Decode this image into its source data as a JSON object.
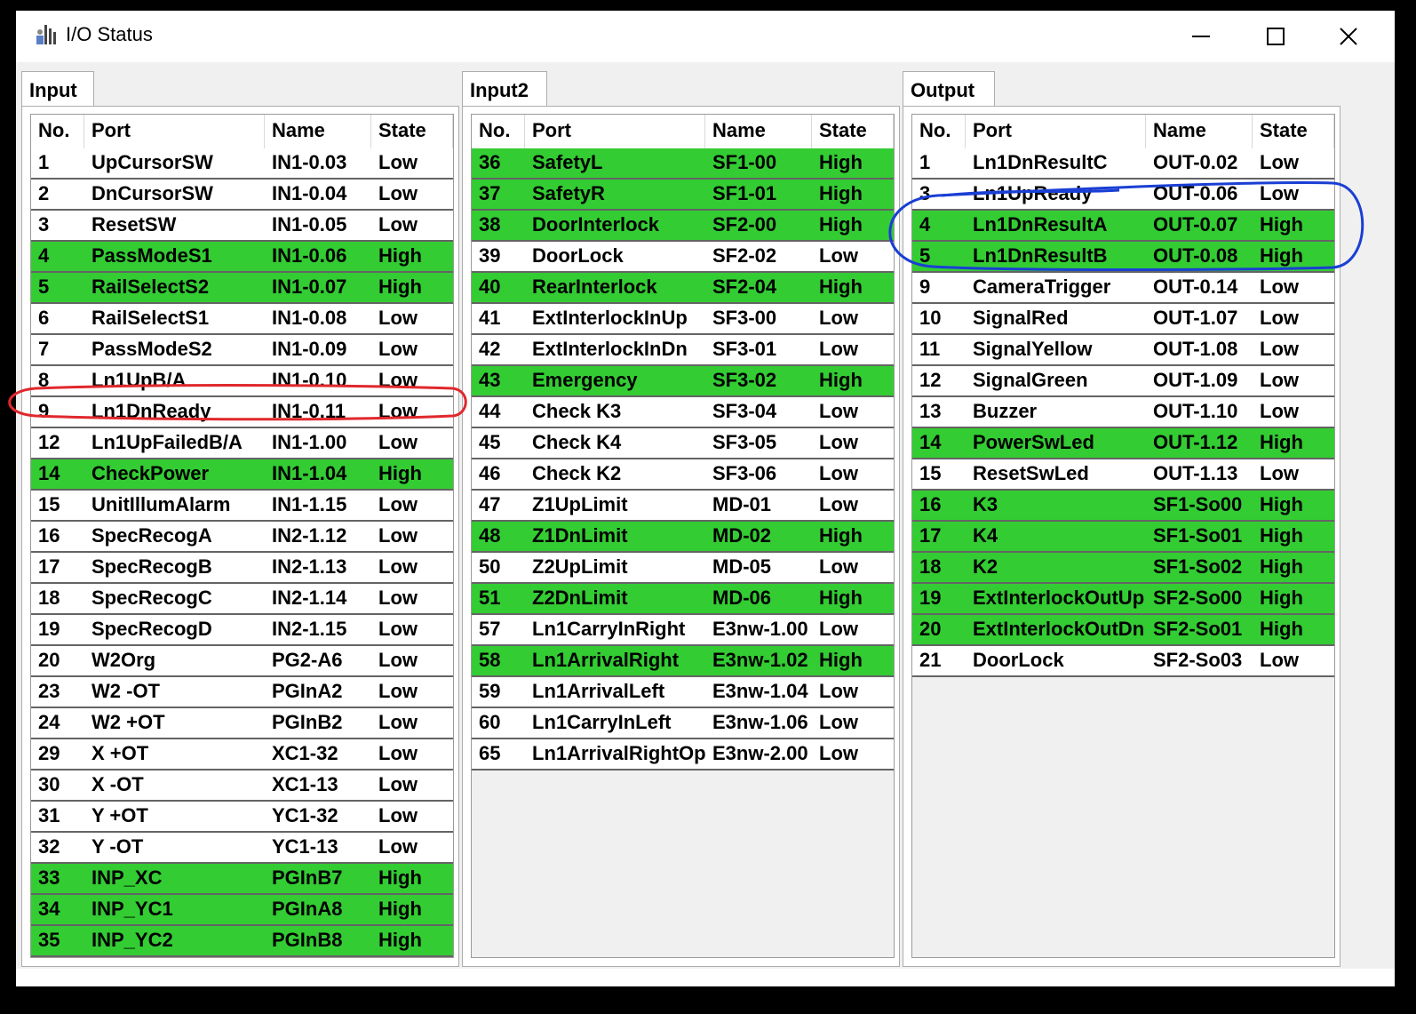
{
  "window": {
    "title": "I/O Status",
    "minimize_glyph": "—",
    "maximize_glyph": "☐",
    "close_glyph": "✕"
  },
  "columns": {
    "no": "No.",
    "port": "Port",
    "name": "Name",
    "state": "State"
  },
  "tabs": [
    {
      "label": "Input",
      "rows": [
        {
          "no": "1",
          "port": "UpCursorSW",
          "name": "IN1-0.03",
          "state": "Low"
        },
        {
          "no": "2",
          "port": "DnCursorSW",
          "name": "IN1-0.04",
          "state": "Low"
        },
        {
          "no": "3",
          "port": "ResetSW",
          "name": "IN1-0.05",
          "state": "Low"
        },
        {
          "no": "4",
          "port": "PassModeS1",
          "name": "IN1-0.06",
          "state": "High"
        },
        {
          "no": "5",
          "port": "RailSelectS2",
          "name": "IN1-0.07",
          "state": "High"
        },
        {
          "no": "6",
          "port": "RailSelectS1",
          "name": "IN1-0.08",
          "state": "Low"
        },
        {
          "no": "7",
          "port": "PassModeS2",
          "name": "IN1-0.09",
          "state": "Low"
        },
        {
          "no": "8",
          "port": "Ln1UpB/A",
          "name": "IN1-0.10",
          "state": "Low"
        },
        {
          "no": "9",
          "port": "Ln1DnReady",
          "name": "IN1-0.11",
          "state": "Low"
        },
        {
          "no": "12",
          "port": "Ln1UpFailedB/A",
          "name": "IN1-1.00",
          "state": "Low"
        },
        {
          "no": "14",
          "port": "CheckPower",
          "name": "IN1-1.04",
          "state": "High"
        },
        {
          "no": "15",
          "port": "UnitIllumAlarm",
          "name": "IN1-1.15",
          "state": "Low"
        },
        {
          "no": "16",
          "port": "SpecRecogA",
          "name": "IN2-1.12",
          "state": "Low"
        },
        {
          "no": "17",
          "port": "SpecRecogB",
          "name": "IN2-1.13",
          "state": "Low"
        },
        {
          "no": "18",
          "port": "SpecRecogC",
          "name": "IN2-1.14",
          "state": "Low"
        },
        {
          "no": "19",
          "port": "SpecRecogD",
          "name": "IN2-1.15",
          "state": "Low"
        },
        {
          "no": "20",
          "port": "W2Org",
          "name": "PG2-A6",
          "state": "Low"
        },
        {
          "no": "23",
          "port": "W2 -OT",
          "name": "PGInA2",
          "state": "Low"
        },
        {
          "no": "24",
          "port": "W2 +OT",
          "name": "PGInB2",
          "state": "Low"
        },
        {
          "no": "29",
          "port": "X +OT",
          "name": "XC1-32",
          "state": "Low"
        },
        {
          "no": "30",
          "port": "X -OT",
          "name": "XC1-13",
          "state": "Low"
        },
        {
          "no": "31",
          "port": "Y +OT",
          "name": "YC1-32",
          "state": "Low"
        },
        {
          "no": "32",
          "port": "Y -OT",
          "name": "YC1-13",
          "state": "Low"
        },
        {
          "no": "33",
          "port": "INP_XC",
          "name": "PGInB7",
          "state": "High"
        },
        {
          "no": "34",
          "port": "INP_YC1",
          "name": "PGInA8",
          "state": "High"
        },
        {
          "no": "35",
          "port": "INP_YC2",
          "name": "PGInB8",
          "state": "High"
        }
      ]
    },
    {
      "label": "Input2",
      "rows": [
        {
          "no": "36",
          "port": "SafetyL",
          "name": "SF1-00",
          "state": "High"
        },
        {
          "no": "37",
          "port": "SafetyR",
          "name": "SF1-01",
          "state": "High"
        },
        {
          "no": "38",
          "port": "DoorInterlock",
          "name": "SF2-00",
          "state": "High"
        },
        {
          "no": "39",
          "port": "DoorLock",
          "name": "SF2-02",
          "state": "Low"
        },
        {
          "no": "40",
          "port": "RearInterlock",
          "name": "SF2-04",
          "state": "High"
        },
        {
          "no": "41",
          "port": "ExtInterlockInUp",
          "name": "SF3-00",
          "state": "Low"
        },
        {
          "no": "42",
          "port": "ExtInterlockInDn",
          "name": "SF3-01",
          "state": "Low"
        },
        {
          "no": "43",
          "port": "Emergency",
          "name": "SF3-02",
          "state": "High"
        },
        {
          "no": "44",
          "port": "Check K3",
          "name": "SF3-04",
          "state": "Low"
        },
        {
          "no": "45",
          "port": "Check K4",
          "name": "SF3-05",
          "state": "Low"
        },
        {
          "no": "46",
          "port": "Check K2",
          "name": "SF3-06",
          "state": "Low"
        },
        {
          "no": "47",
          "port": "Z1UpLimit",
          "name": "MD-01",
          "state": "Low"
        },
        {
          "no": "48",
          "port": "Z1DnLimit",
          "name": "MD-02",
          "state": "High"
        },
        {
          "no": "50",
          "port": "Z2UpLimit",
          "name": "MD-05",
          "state": "Low"
        },
        {
          "no": "51",
          "port": "Z2DnLimit",
          "name": "MD-06",
          "state": "High"
        },
        {
          "no": "57",
          "port": "Ln1CarryInRight",
          "name": "E3nw-1.00",
          "state": "Low"
        },
        {
          "no": "58",
          "port": "Ln1ArrivalRight",
          "name": "E3nw-1.02",
          "state": "High"
        },
        {
          "no": "59",
          "port": "Ln1ArrivalLeft",
          "name": "E3nw-1.04",
          "state": "Low"
        },
        {
          "no": "60",
          "port": "Ln1CarryInLeft",
          "name": "E3nw-1.06",
          "state": "Low"
        },
        {
          "no": "65",
          "port": "Ln1ArrivalRightOp",
          "name": "E3nw-2.00",
          "state": "Low"
        }
      ]
    },
    {
      "label": "Output",
      "rows": [
        {
          "no": "1",
          "port": "Ln1DnResultC",
          "name": "OUT-0.02",
          "state": "Low"
        },
        {
          "no": "3",
          "port": "Ln1UpReady",
          "name": "OUT-0.06",
          "state": "Low"
        },
        {
          "no": "4",
          "port": "Ln1DnResultA",
          "name": "OUT-0.07",
          "state": "High"
        },
        {
          "no": "5",
          "port": "Ln1DnResultB",
          "name": "OUT-0.08",
          "state": "High"
        },
        {
          "no": "9",
          "port": "CameraTrigger",
          "name": "OUT-0.14",
          "state": "Low"
        },
        {
          "no": "10",
          "port": "SignalRed",
          "name": "OUT-1.07",
          "state": "Low"
        },
        {
          "no": "11",
          "port": "SignalYellow",
          "name": "OUT-1.08",
          "state": "Low"
        },
        {
          "no": "12",
          "port": "SignalGreen",
          "name": "OUT-1.09",
          "state": "Low"
        },
        {
          "no": "13",
          "port": "Buzzer",
          "name": "OUT-1.10",
          "state": "Low"
        },
        {
          "no": "14",
          "port": "PowerSwLed",
          "name": "OUT-1.12",
          "state": "High"
        },
        {
          "no": "15",
          "port": "ResetSwLed",
          "name": "OUT-1.13",
          "state": "Low"
        },
        {
          "no": "16",
          "port": "K3",
          "name": "SF1-So00",
          "state": "High"
        },
        {
          "no": "17",
          "port": "K4",
          "name": "SF1-So01",
          "state": "High"
        },
        {
          "no": "18",
          "port": "K2",
          "name": "SF1-So02",
          "state": "High"
        },
        {
          "no": "19",
          "port": "ExtInterlockOutUp",
          "name": "SF2-So00",
          "state": "High"
        },
        {
          "no": "20",
          "port": "ExtInterlockOutDn",
          "name": "SF2-So01",
          "state": "High"
        },
        {
          "no": "21",
          "port": "DoorLock",
          "name": "SF2-So03",
          "state": "Low"
        }
      ]
    }
  ],
  "colors": {
    "high_row": "#33cc33",
    "low_row": "#ffffff",
    "red_annotation": "#e0282c",
    "blue_annotation": "#1a3fd4"
  }
}
